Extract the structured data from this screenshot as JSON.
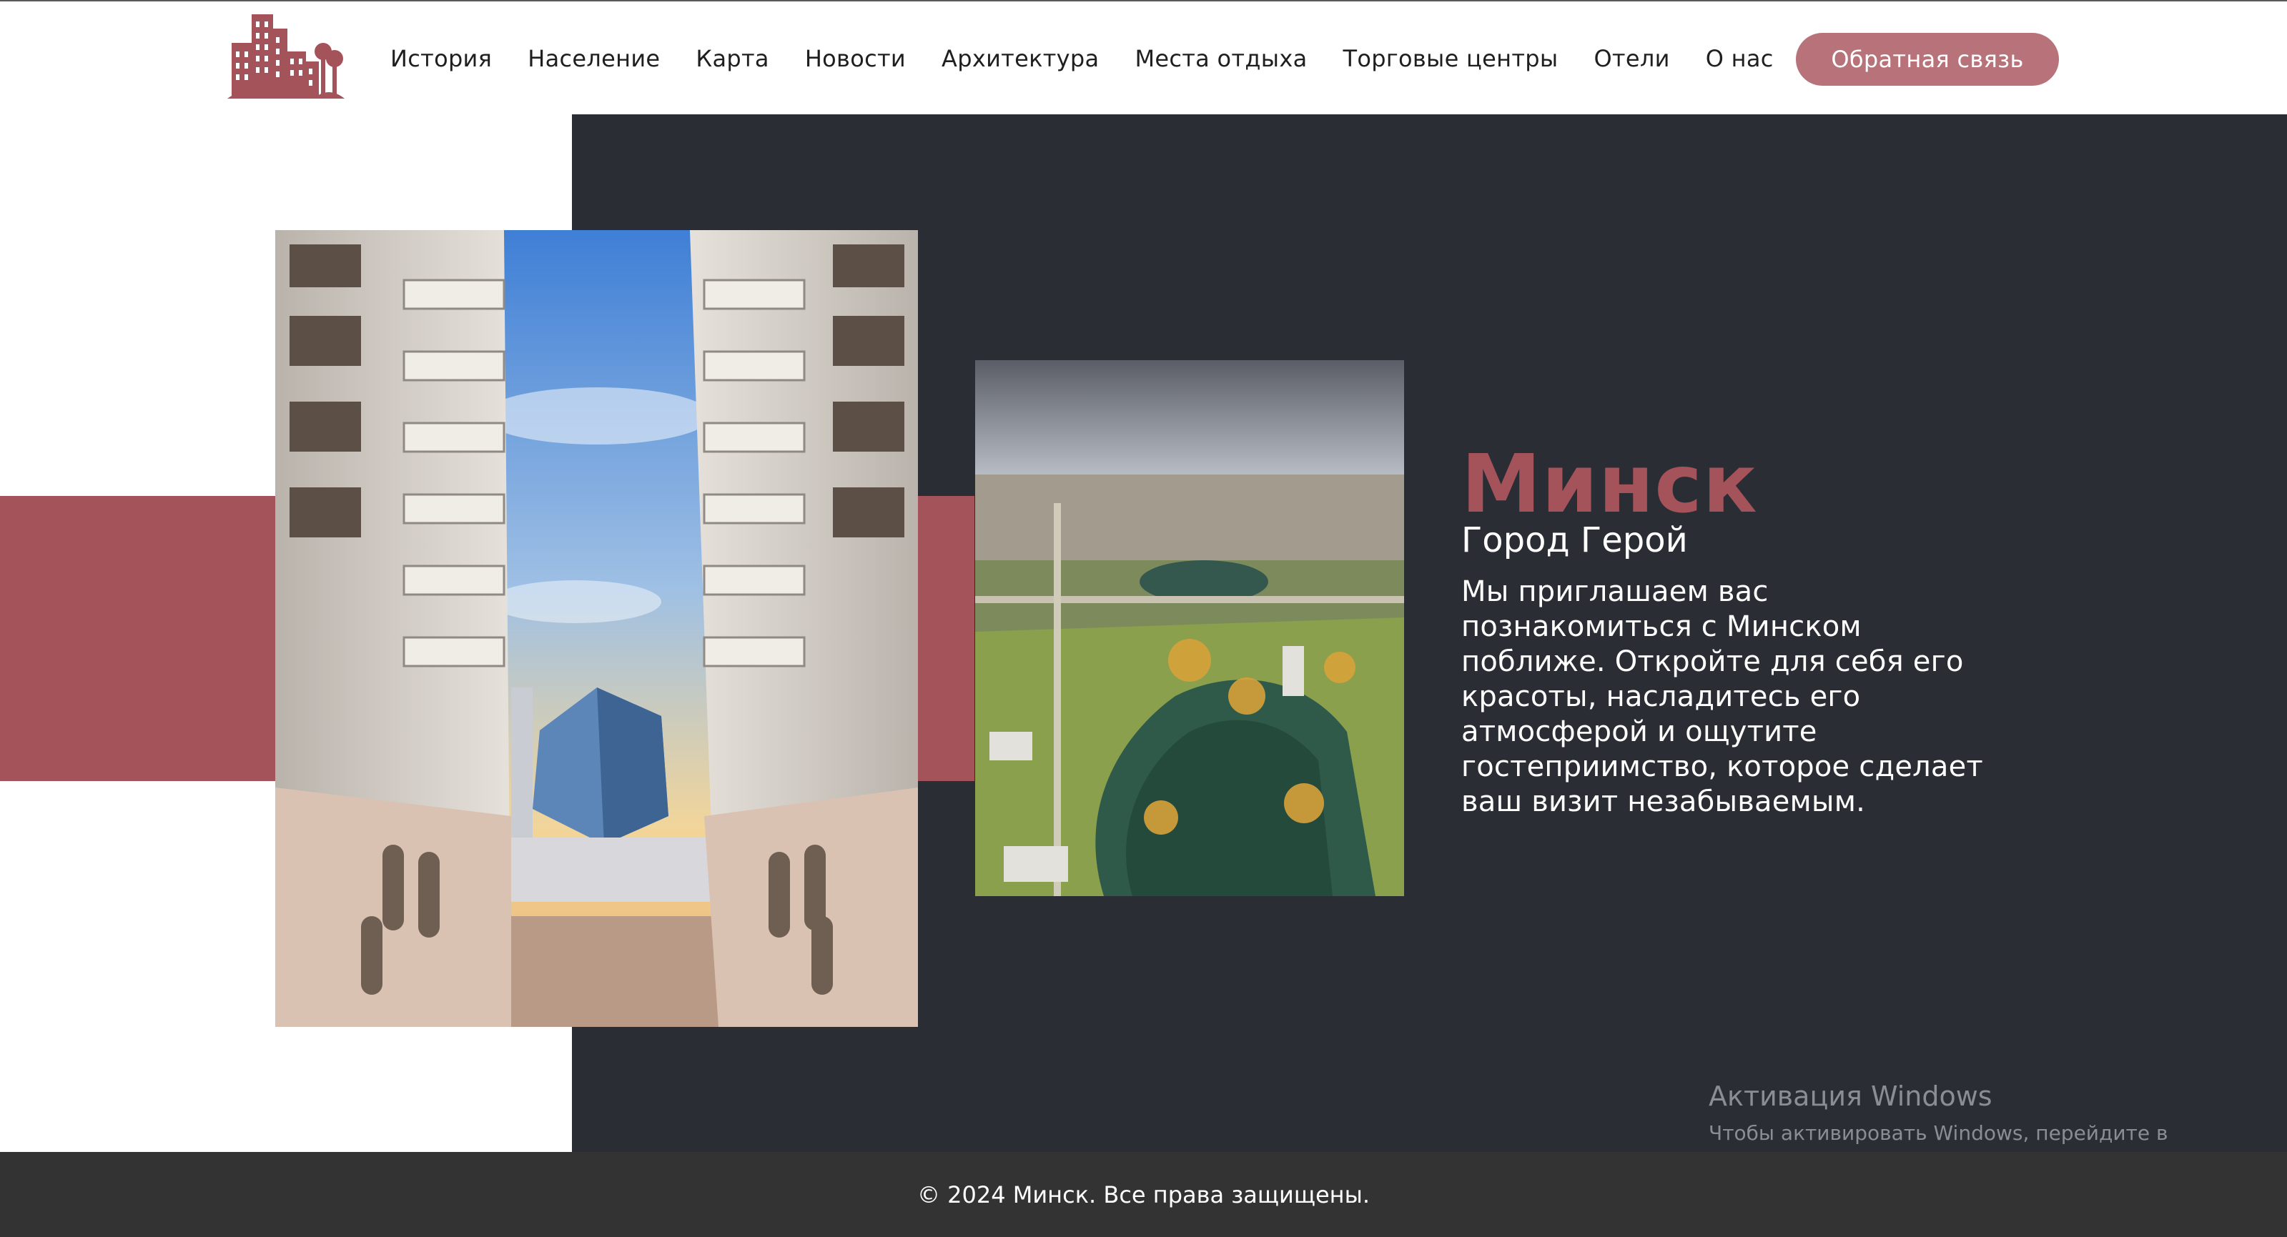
{
  "header": {
    "nav": [
      "История",
      "Население",
      "Карта",
      "Новости",
      "Архитектура",
      "Места отдыха",
      "Торговые центры",
      "Отели",
      "О нас"
    ],
    "feedback_label": "Обратная связь"
  },
  "hero": {
    "title": "Минск",
    "subtitle": "Город Герой",
    "description": "Мы приглашаем вас познакомиться с Минском поближе. Откройте для себя его красоты, насладитесь его атмосферой и ощутите гостеприимство, которое сделает ваш визит незабываемым."
  },
  "watermark": {
    "title": "Активация Windows",
    "text": "Чтобы активировать Windows, перейдите в раздел \"Параметры\"."
  },
  "footer": {
    "copyright": "© 2024 Минск. Все права защищены."
  },
  "colors": {
    "accent": "#a5535a",
    "button": "#b8737a",
    "dark_panel": "#2b2d34",
    "footer": "#333333"
  },
  "icons": [
    "city-logo-icon"
  ]
}
